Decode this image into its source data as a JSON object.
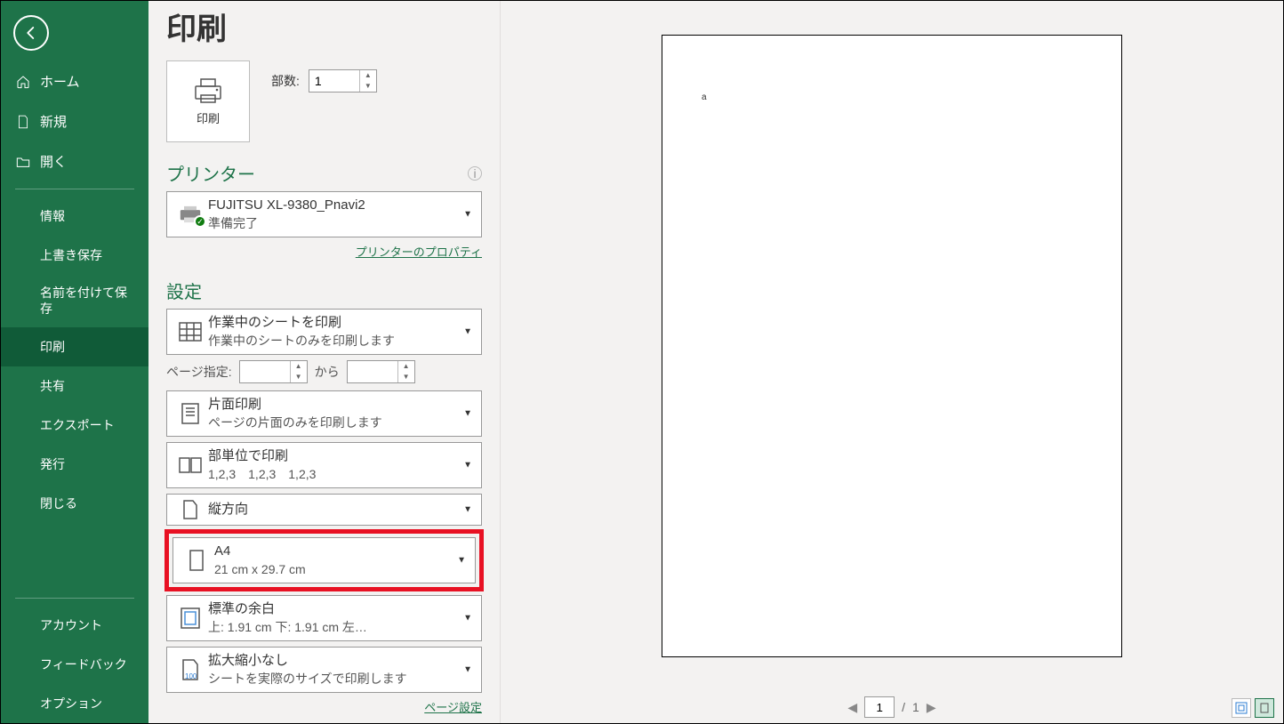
{
  "sidebar": {
    "items": [
      {
        "label": "ホーム"
      },
      {
        "label": "新規"
      },
      {
        "label": "開く"
      },
      {
        "label": "情報"
      },
      {
        "label": "上書き保存"
      },
      {
        "label": "名前を付けて保存"
      },
      {
        "label": "印刷"
      },
      {
        "label": "共有"
      },
      {
        "label": "エクスポート"
      },
      {
        "label": "発行"
      },
      {
        "label": "閉じる"
      },
      {
        "label": "アカウント"
      },
      {
        "label": "フィードバック"
      },
      {
        "label": "オプション"
      }
    ]
  },
  "page": {
    "title": "印刷",
    "print_button": "印刷",
    "copies_label": "部数:",
    "copies_value": "1"
  },
  "printer": {
    "section": "プリンター",
    "name": "FUJITSU XL-9380_Pnavi2",
    "status": "準備完了",
    "properties_link": "プリンターのプロパティ"
  },
  "settings": {
    "section": "設定",
    "scope": {
      "main": "作業中のシートを印刷",
      "sub": "作業中のシートのみを印刷します"
    },
    "pages_label": "ページ指定:",
    "pages_from": "",
    "pages_to_label": "から",
    "pages_to": "",
    "sides": {
      "main": "片面印刷",
      "sub": "ページの片面のみを印刷します"
    },
    "collate": {
      "main": "部単位で印刷",
      "sub": "1,2,3　1,2,3　1,2,3"
    },
    "orientation": {
      "main": "縦方向"
    },
    "paper": {
      "main": "A4",
      "sub": "21 cm x 29.7 cm"
    },
    "margins": {
      "main": "標準の余白",
      "sub": "上: 1.91 cm 下: 1.91 cm 左…"
    },
    "scaling": {
      "main": "拡大縮小なし",
      "sub": "シートを実際のサイズで印刷します"
    },
    "page_setup_link": "ページ設定"
  },
  "preview": {
    "content_a": "a",
    "current_page": "1",
    "total_pages": "1",
    "separator": "/"
  }
}
